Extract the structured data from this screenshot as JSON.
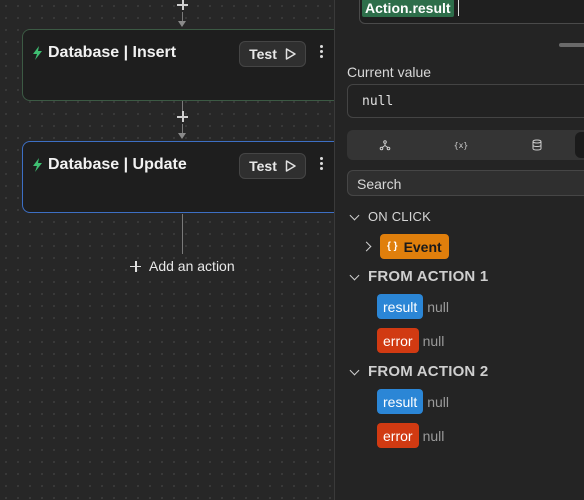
{
  "canvas": {
    "nodes": [
      {
        "title": "Database | Insert",
        "test_label": "Test"
      },
      {
        "title": "Database | Update",
        "test_label": "Test"
      }
    ],
    "add_action_label": "Add an action"
  },
  "panel": {
    "expression_token": "Action.result",
    "current_value_label": "Current value",
    "current_value": "null",
    "tabs": [
      {
        "icon": "merge-icon"
      },
      {
        "icon": "variable-icon"
      },
      {
        "icon": "database-icon"
      },
      {
        "icon": "blank-tab"
      }
    ],
    "search_placeholder": "Search",
    "tree": {
      "on_click": {
        "label": "ON CLICK",
        "event_label": "Event"
      },
      "action1": {
        "label": "FROM ACTION 1",
        "items": [
          {
            "name": "result",
            "value": "null"
          },
          {
            "name": "error",
            "value": "null"
          }
        ]
      },
      "action2": {
        "label": "FROM ACTION 2",
        "items": [
          {
            "name": "result",
            "value": "null"
          },
          {
            "name": "error",
            "value": "null"
          }
        ]
      }
    }
  },
  "colors": {
    "result_chip": "#2b86d6",
    "error_chip": "#d13a12",
    "event_chip": "#e07f0c",
    "token": "#2d6e4a",
    "selected_border": "#3d6fc4"
  }
}
